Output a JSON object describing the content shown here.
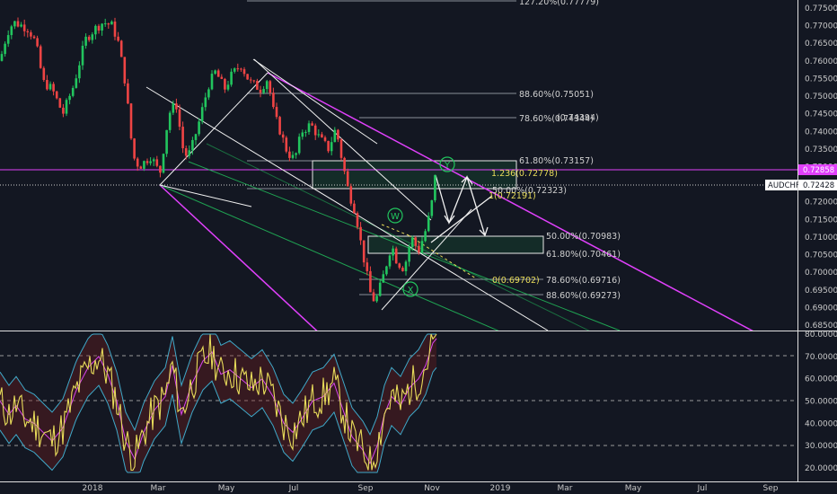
{
  "chart_data": [
    {
      "type": "candlestick",
      "symbol": "AUDCHF",
      "last_price": "0.72428",
      "magenta_level": "0.72858",
      "y_ticks": [
        "0.77500",
        "0.77000",
        "0.76500",
        "0.76000",
        "0.75500",
        "0.75000",
        "0.74500",
        "0.74000",
        "0.73500",
        "0.73000",
        "0.72500",
        "0.72000",
        "0.71500",
        "0.71000",
        "0.70500",
        "0.70000",
        "0.69500",
        "0.69000",
        "0.68500"
      ],
      "x_ticks": [
        "2018",
        "Mar",
        "May",
        "Jul",
        "Sep",
        "Nov",
        "2019",
        "Mar",
        "May",
        "Jul",
        "Sep"
      ],
      "ylim": [
        0.684,
        0.779
      ],
      "fib_levels": [
        {
          "label": "127.20%(0.77779)",
          "value": 0.77779
        },
        {
          "label": "88.60%(0.75051)",
          "value": 0.75051
        },
        {
          "label": "78.60%(0.74344)",
          "value": 0.74344
        },
        {
          "label": "61.80%(0.73157)",
          "value": 0.73157
        },
        {
          "label": "50.00%(0.72323)",
          "value": 0.72323
        },
        {
          "label": "50.00%(0.70983)",
          "value": 0.70983
        },
        {
          "label": "61.80%(0.70461)",
          "value": 0.70461
        },
        {
          "label": "78.60%(0.69716)",
          "value": 0.69716
        },
        {
          "label": "88.60%(0.69273)",
          "value": 0.69273
        }
      ],
      "extension_levels": [
        {
          "label": "1.236(0.72778)",
          "value": 0.72778
        },
        {
          "label": "1(0.72191)",
          "value": 0.72191
        },
        {
          "label": "0(0.69702)",
          "value": 0.69702
        }
      ],
      "overlap_labels": [
        "(0.74394)"
      ],
      "wave_labels": [
        "W",
        "X",
        "Y"
      ],
      "colors": {
        "background": "#131722",
        "up_candle": "#22c55e",
        "down_candle": "#ef4444",
        "channel": "#e040fb",
        "green_lines": "#22c55e",
        "white_lines": "#ffffff",
        "fib_yellow": "#e8dc5a",
        "last_price_tag": "#ffffff"
      }
    },
    {
      "type": "line",
      "indicator": "RSI with bands",
      "y_ticks": [
        "80.0000",
        "70.0000",
        "60.0000",
        "50.0000",
        "40.0000",
        "30.0000",
        "20.0000"
      ],
      "ylim": [
        18,
        81
      ],
      "levels": [
        70,
        50,
        30
      ],
      "colors": {
        "rsi": "#e8dc5a",
        "signal": "#d946ef",
        "band": "#3fa9c9"
      }
    }
  ]
}
